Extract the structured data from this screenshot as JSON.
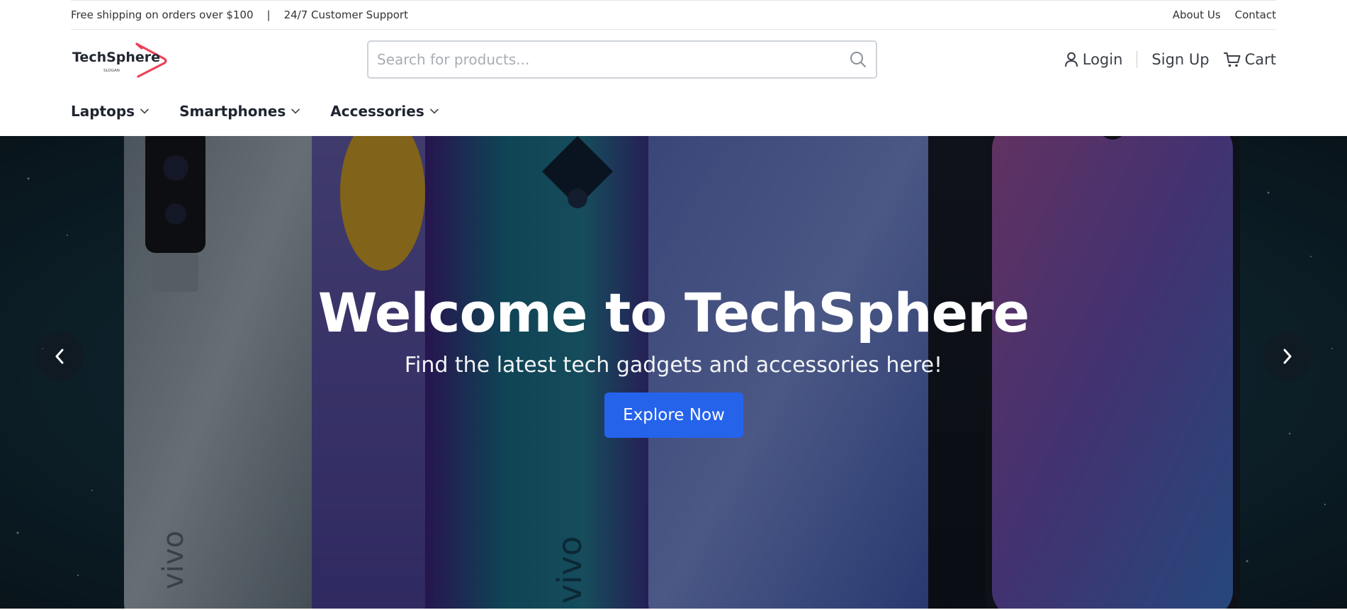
{
  "topbar": {
    "shipping_text": "Free shipping on orders over $100",
    "separator": "|",
    "support_text": "24/7 Customer Support",
    "links": [
      "About Us",
      "Contact"
    ]
  },
  "brand": {
    "name": "TechSphere",
    "slogan": "SLOGAN",
    "accent_color": "#e8425a"
  },
  "search": {
    "placeholder": "Search for products...",
    "value": "",
    "icon": "search-icon"
  },
  "user_actions": {
    "login": "Login",
    "signup": "Sign Up",
    "cart": "Cart"
  },
  "nav": {
    "items": [
      "Laptops",
      "Smartphones",
      "Accessories"
    ]
  },
  "hero": {
    "title": "Welcome to TechSphere",
    "subtitle": "Find the latest tech gadgets and accessories here!",
    "cta": "Explore Now",
    "cta_color": "#2563eb",
    "phone_branding": [
      "vivo",
      "vivo"
    ]
  },
  "carousel": {
    "prev_icon": "chevron-left-icon",
    "next_icon": "chevron-right-icon"
  }
}
